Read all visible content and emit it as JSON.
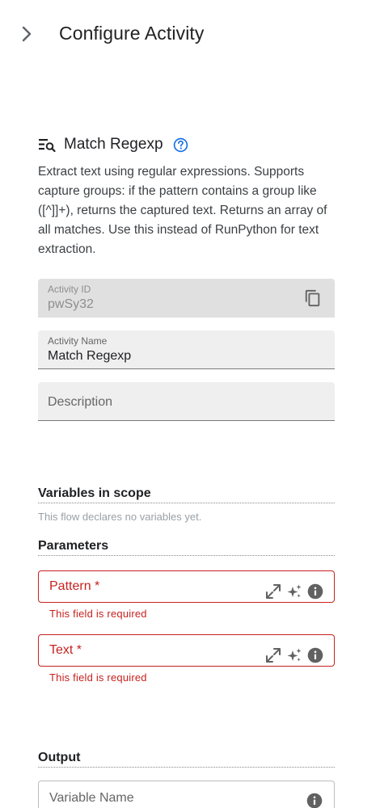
{
  "header": {
    "title": "Configure Activity",
    "toggle_icon": "chevron-right-icon"
  },
  "activity": {
    "icon": "regex-search-icon",
    "title": "Match Regexp",
    "help_icon": "help-circle-icon",
    "description": "Extract text using regular expressions. Supports capture groups: if the pattern contains a group like ([^]]+), returns the captured text. Returns an array of all matches. Use this instead of RunPython for text extraction."
  },
  "fields": {
    "activity_id": {
      "label": "Activity ID",
      "value": "pwSy32",
      "icon": "copy-icon"
    },
    "activity_name": {
      "label": "Activity Name",
      "value": "Match Regexp"
    },
    "description": {
      "placeholder": "Description"
    }
  },
  "variables": {
    "heading": "Variables in scope",
    "empty_text": "This flow declares no variables yet."
  },
  "parameters": {
    "heading": "Parameters",
    "items": [
      {
        "label": "Pattern *",
        "error": "This field is required"
      },
      {
        "label": "Text *",
        "error": "This field is required"
      }
    ]
  },
  "output": {
    "heading": "Output",
    "placeholder": "Variable Name"
  },
  "colors": {
    "error": "#c5221f",
    "help": "#1a73e8",
    "icon_gray": "#616161"
  }
}
